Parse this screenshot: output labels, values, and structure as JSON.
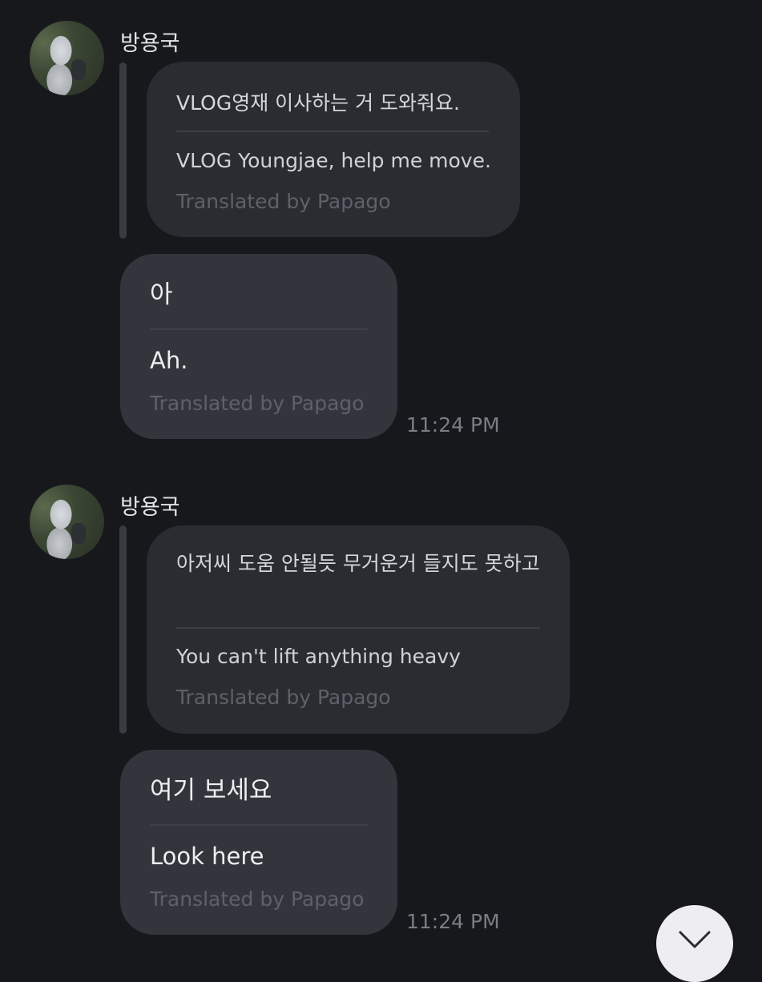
{
  "messages": [
    {
      "sender": "방용국",
      "original": "VLOG영재 이사하는 거 도와줘요.",
      "translation": "VLOG Youngjae, help me move.",
      "translated_by": "Translated by Papago"
    },
    {
      "original": "아",
      "translation": "Ah.",
      "translated_by": "Translated by Papago",
      "time": "11:24 PM"
    },
    {
      "sender": "방용국",
      "original": "아저씨 도움 안될듯 무거운거 들지도 못하고",
      "translation": "You can't lift anything heavy",
      "translated_by": "Translated by Papago"
    },
    {
      "original": "여기 보세요",
      "translation": "Look here",
      "translated_by": "Translated by Papago",
      "time": "11:24 PM"
    }
  ],
  "scroll_button_icon": "chevron-down-icon"
}
